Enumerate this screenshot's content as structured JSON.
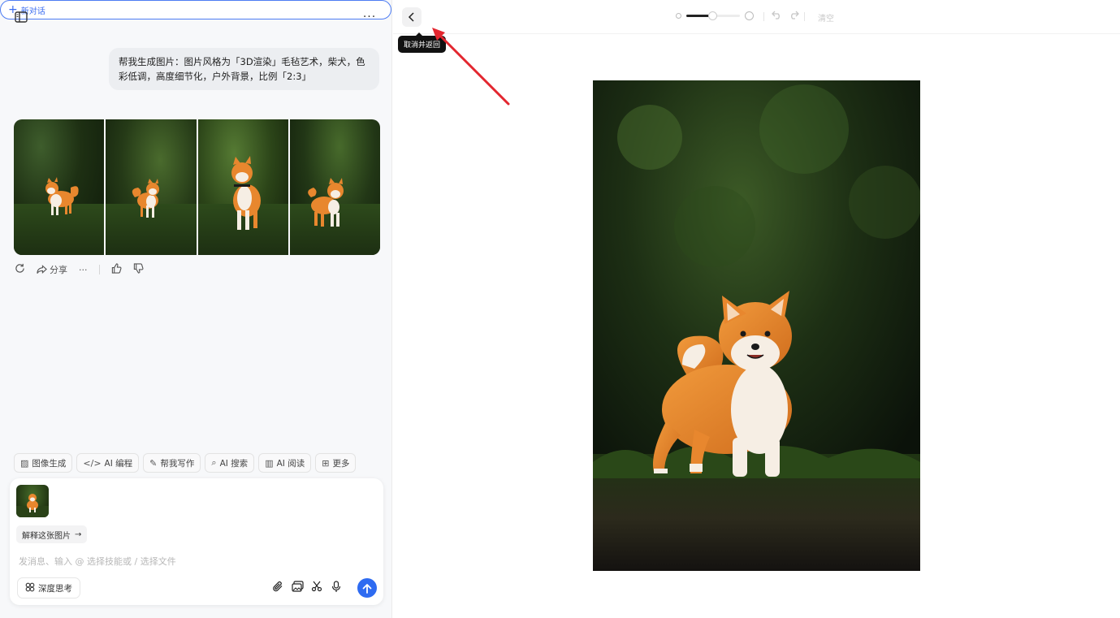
{
  "sidebar_toggle": {
    "icon": "sidebar-toggle-icon"
  },
  "new_chat": {
    "label": "新对话",
    "icon": "plus-icon"
  },
  "top_more": {
    "icon": "more-horizontal-icon",
    "label": "···"
  },
  "user_message": {
    "text": "帮我生成图片：图片风格为「3D渲染」毛毡艺术，柴犬，色彩低调，高度细节化，户外背景，比例「2:3」"
  },
  "generated_images": {
    "count": 4,
    "subject": "shiba-inu"
  },
  "message_actions": {
    "regenerate_icon": "refresh-icon",
    "share_label": "分享",
    "share_icon": "share-icon",
    "more_icon": "more-horizontal-icon",
    "more_label": "···",
    "like_icon": "thumbs-up-icon",
    "dislike_icon": "thumbs-down-icon"
  },
  "skill_chips": [
    {
      "label": "图像生成",
      "icon": "image-icon"
    },
    {
      "label": "AI 编程",
      "icon": "code-icon"
    },
    {
      "label": "帮我写作",
      "icon": "pen-icon"
    },
    {
      "label": "AI 搜索",
      "icon": "search-icon"
    },
    {
      "label": "AI 阅读",
      "icon": "book-icon"
    },
    {
      "label": "更多",
      "icon": "grid-icon"
    }
  ],
  "composer": {
    "explain_label": "解释这张图片",
    "explain_arrow": "→",
    "placeholder": "发消息、输入 @ 选择技能或 / 选择文件",
    "deep_think_label": "深度思考",
    "tools": [
      "paperclip-icon",
      "image-library-icon",
      "scissors-icon",
      "microphone-icon"
    ],
    "send_icon": "send-arrow-icon"
  },
  "editor": {
    "back_icon": "chevron-left-icon",
    "tooltip": "取消并返回",
    "zoom_level": 0.48,
    "undo_icon": "undo-icon",
    "redo_icon": "redo-icon",
    "clear_label": "清空"
  },
  "colors": {
    "accent": "#2e6bf1",
    "annotation_arrow": "#e3262f"
  }
}
